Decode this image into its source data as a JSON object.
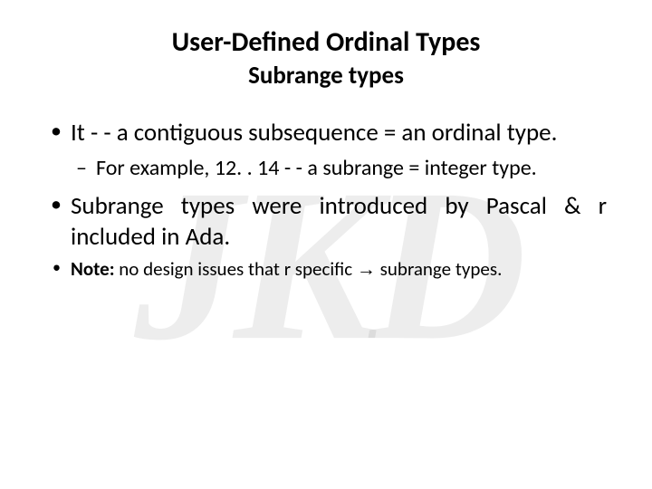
{
  "watermark": "JKD",
  "title": "User-Defined Ordinal Types",
  "subtitle": "Subrange types",
  "bullets": {
    "b1": "It - - a contiguous subsequence = an ordinal type.",
    "sub1": "For example, 12. . 14 - - a subrange = integer type.",
    "b2": "Subrange types were introduced by Pascal & r included in Ada.",
    "note_label": "Note:",
    "note_text": " no design issues that r specific ",
    "note_arrow": "→",
    "note_tail": " subrange types."
  }
}
